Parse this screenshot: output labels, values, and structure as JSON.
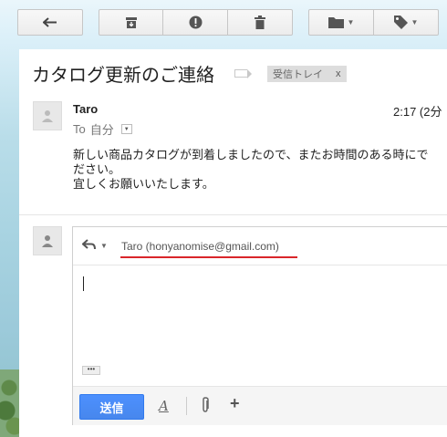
{
  "toolbar": {
    "buttons": [
      {
        "name": "back",
        "icon": "back-arrow-icon"
      },
      {
        "name": "archive",
        "icon": "archive-icon"
      },
      {
        "name": "spam",
        "icon": "report-spam-icon"
      },
      {
        "name": "delete",
        "icon": "trash-icon"
      },
      {
        "name": "move",
        "icon": "folder-icon"
      },
      {
        "name": "labels",
        "icon": "tag-icon"
      }
    ]
  },
  "thread": {
    "subject": "カタログ更新のご連絡",
    "label_tag": "受信トレイ",
    "label_close": "x"
  },
  "message": {
    "sender": "Taro",
    "time": "2:17 (2分",
    "to_prefix": "To",
    "to_me": "自分",
    "body": [
      "新しい商品カタログが到着しましたので、またお時間のある時にで",
      "ださい。",
      "宜しくお願いいたします。"
    ]
  },
  "reply": {
    "recipient": "Taro (honyanomise@gmail.com)",
    "more_label": "•••",
    "send_label": "送信",
    "format_label": "A",
    "add_label": "+"
  },
  "colors": {
    "accent_blue": "#4d90fe",
    "highlight_red": "#d9262b",
    "panel_bg": "#ffffff",
    "toolbar_bg": "#f5f5f5"
  }
}
